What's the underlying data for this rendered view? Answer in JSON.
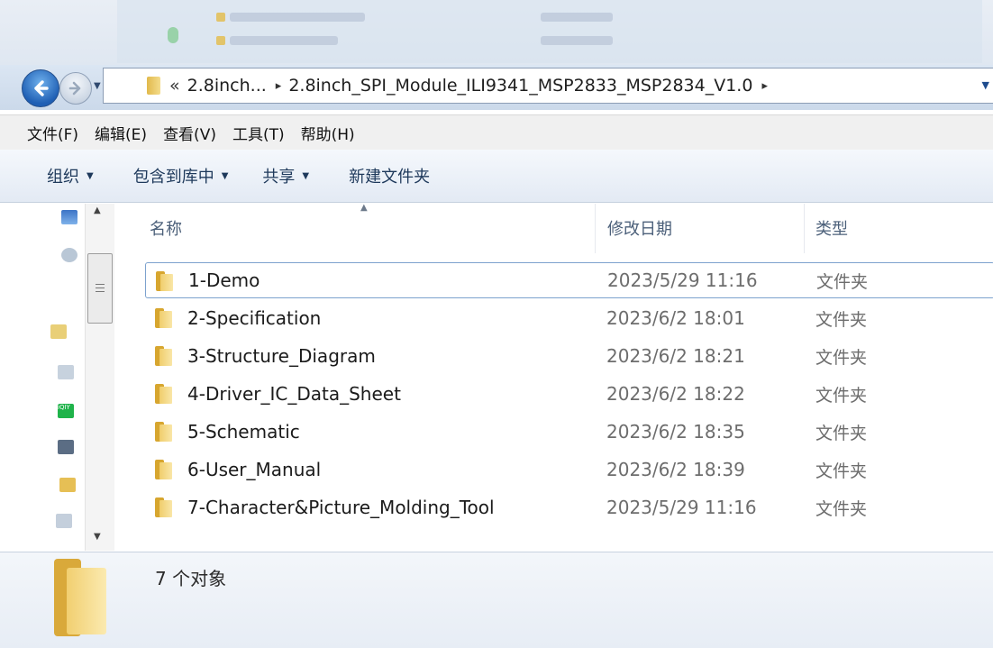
{
  "window": {
    "address": {
      "chevron": "«",
      "segments": [
        "2.8inch...",
        "2.8inch_SPI_Module_ILI9341_MSP2833_MSP2834_V1.0"
      ],
      "separator": "▸"
    },
    "icons": {
      "back": "back-arrow-icon",
      "forward": "forward-arrow-icon",
      "folder": "folder-icon"
    }
  },
  "menubar": {
    "items": [
      "文件(F)",
      "编辑(E)",
      "查看(V)",
      "工具(T)",
      "帮助(H)"
    ]
  },
  "commandbar": {
    "organize": "组织",
    "include_in_library": "包含到库中",
    "share": "共享",
    "new_folder": "新建文件夹"
  },
  "list": {
    "headers": {
      "name": "名称",
      "date_modified": "修改日期",
      "type": "类型"
    },
    "rows": [
      {
        "name": "1-Demo",
        "date": "2023/5/29 11:16",
        "type": "文件夹"
      },
      {
        "name": "2-Specification",
        "date": "2023/6/2 18:01",
        "type": "文件夹"
      },
      {
        "name": "3-Structure_Diagram",
        "date": "2023/6/2 18:21",
        "type": "文件夹"
      },
      {
        "name": "4-Driver_IC_Data_Sheet",
        "date": "2023/6/2 18:22",
        "type": "文件夹"
      },
      {
        "name": "5-Schematic",
        "date": "2023/6/2 18:35",
        "type": "文件夹"
      },
      {
        "name": "6-User_Manual",
        "date": "2023/6/2 18:39",
        "type": "文件夹"
      },
      {
        "name": "7-Character&Picture_Molding_Tool",
        "date": "2023/5/29 11:16",
        "type": "文件夹"
      }
    ]
  },
  "details": {
    "status": "7 个对象"
  },
  "colors": {
    "accent": "#1f5fb4",
    "folder": "#e8c25a",
    "selection_border": "#7da2ce"
  }
}
